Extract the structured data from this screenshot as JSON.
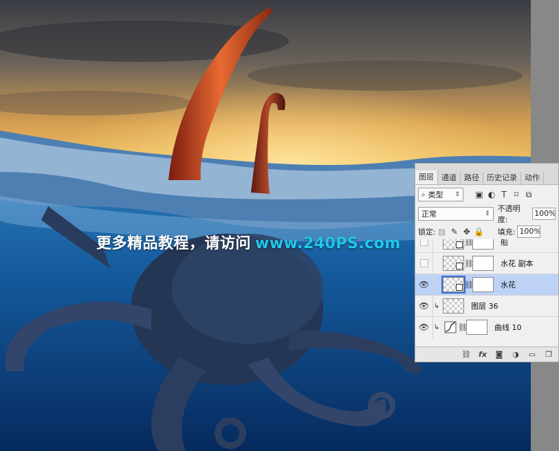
{
  "watermark": {
    "text_cn": "更多精品教程，请访问",
    "text_url": "www.240PS.com"
  },
  "panel": {
    "tabs": [
      "图层",
      "通道",
      "路径",
      "历史记录",
      "动作"
    ],
    "filter": {
      "icon": "search-icon",
      "label": "类型"
    },
    "blend_mode": "正常",
    "opacity_label": "不透明度:",
    "opacity_value": "100%",
    "lock_label": "锁定:",
    "fill_label": "填充:",
    "fill_value": "100%",
    "layers": [
      {
        "name": "船",
        "visible": false,
        "selected": false
      },
      {
        "name": "水花 副本",
        "visible": false,
        "selected": false
      },
      {
        "name": "水花",
        "visible": true,
        "selected": true
      },
      {
        "name": "图层 36",
        "visible": true,
        "selected": false
      },
      {
        "name": "曲线 10",
        "visible": true,
        "selected": false
      }
    ],
    "bottom_icons": [
      "link-icon",
      "fx-icon",
      "mask-icon",
      "adjustment-icon",
      "folder-icon",
      "new-layer-icon"
    ],
    "bottom_fx_label": "fx"
  },
  "colors": {
    "selected_row": "#bed2f6",
    "url": "#22c6e9"
  }
}
